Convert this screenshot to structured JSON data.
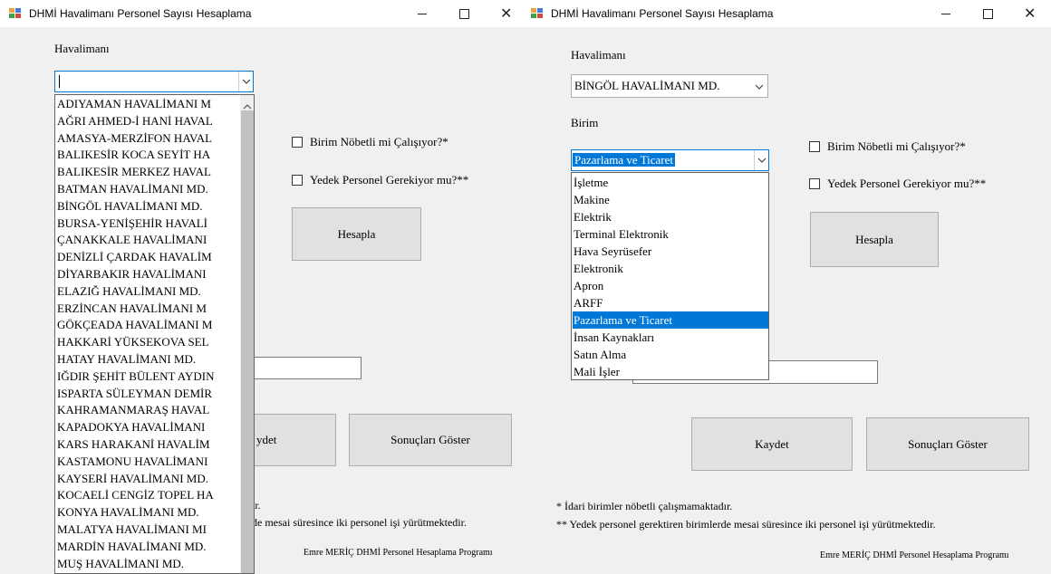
{
  "left_window": {
    "title": "DHMİ Havalimanı Personel Sayısı Hesaplama",
    "controls": {
      "minimize": "–",
      "maximize": "☐",
      "close": "✕"
    },
    "airport_label": "Havalimanı",
    "airport_value": "",
    "checkbox_shift": "Birim Nöbetli mi Çalışıyor?*",
    "checkbox_reserve": "Yedek Personel Gerekiyor mu?**",
    "calculate_button": "Hesapla",
    "save_button_partial": "ydet",
    "results_button": "Sonuçları Göster",
    "note1_partial": "ır.",
    "note2_partial": "de mesai süresince iki personel işi yürütmektedir.",
    "footer": "Emre MERİÇ DHMİ Personel Hesaplama Programı",
    "airport_options": [
      "ADIYAMAN HAVALİMANI M",
      "AĞRI AHMED-İ HANİ HAVAL",
      "AMASYA-MERZİFON HAVAL",
      "BALIKESİR KOCA SEYİT HA",
      "BALIKESİR MERKEZ HAVAL",
      "BATMAN HAVALİMANI MD.",
      "BİNGÖL HAVALİMANI MD.",
      "BURSA-YENİŞEHİR HAVALİ",
      "ÇANAKKALE HAVALİMANI",
      "DENİZLİ ÇARDAK HAVALİM",
      "DİYARBAKIR HAVALİMANI",
      "ELAZIĞ HAVALİMANI MD.",
      "ERZİNCAN HAVALİMANI M",
      "GÖKÇEADA HAVALİMANI M",
      "HAKKARİ YÜKSEKOVA SEL",
      "HATAY HAVALİMANI MD.",
      "IĞDIR ŞEHİT BÜLENT AYDIN",
      "ISPARTA SÜLEYMAN DEMİR",
      "KAHRAMANMARAŞ HAVAL",
      "KAPADOKYA HAVALİMANI",
      "KARS HARAKANİ HAVALİM",
      "KASTAMONU HAVALİMANI",
      "KAYSERİ HAVALİMANI MD.",
      "KOCAELİ CENGİZ TOPEL HA",
      "KONYA HAVALİMANI MD.",
      "MALATYA HAVALİMANI MI",
      "MARDİN HAVALİMANI MD.",
      "MUŞ HAVALİMANI MD."
    ]
  },
  "right_window": {
    "title": "DHMİ Havalimanı Personel Sayısı Hesaplama",
    "controls": {
      "minimize": "–",
      "maximize": "☐",
      "close": "✕"
    },
    "airport_label": "Havalimanı",
    "airport_value": "BİNGÖL HAVALİMANI MD.",
    "unit_label": "Birim",
    "unit_value": "Pazarlama ve Ticaret",
    "checkbox_shift": "Birim Nöbetli mi Çalışıyor?*",
    "checkbox_reserve": "Yedek Personel Gerekiyor mu?**",
    "calculate_button": "Hesapla",
    "save_button": "Kaydet",
    "results_button": "Sonuçları Göster",
    "note1": "* İdari birimler nöbetli çalışmamaktadır.",
    "note2": "** Yedek personel gerektiren birimlerde mesai süresince iki personel işi yürütmektedir.",
    "footer": "Emre MERİÇ DHMİ Personel Hesaplama Programı",
    "unit_options": [
      "İşletme",
      "Makine",
      "Elektrik",
      "Terminal Elektronik",
      "Hava Seyrüsefer",
      "Elektronik",
      "Apron",
      "ARFF",
      "Pazarlama ve Ticaret",
      "İnsan Kaynakları",
      "Satın Alma",
      "Mali İşler"
    ],
    "selected_unit_index": 8
  },
  "colors": {
    "selection": "#0078d7",
    "window_bg": "#f0f0f0",
    "button_bg": "#e1e1e1"
  }
}
